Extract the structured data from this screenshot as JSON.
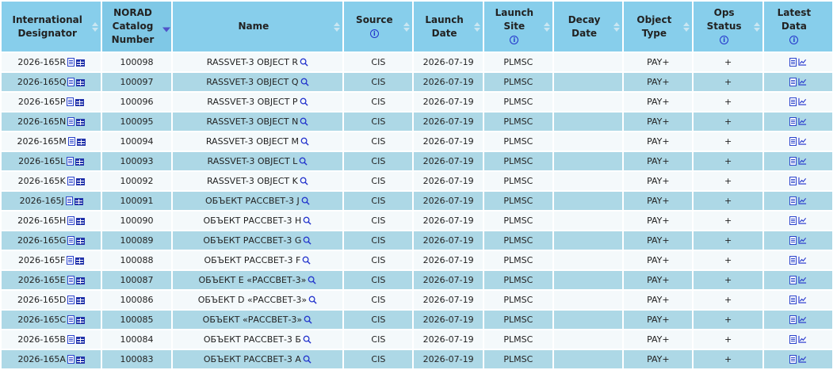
{
  "headers": {
    "intl": "International Designator",
    "norad": "NORAD Catalog Number",
    "name": "Name",
    "source": "Source",
    "launch_date": "Launch Date",
    "launch_site": "Launch Site",
    "decay": "Decay Date",
    "object_type": "Object Type",
    "ops_status": "Ops Status",
    "latest": "Latest Data",
    "info_glyph": "i"
  },
  "colors": {
    "header_bg": "#87ceeb",
    "row_light": "#f4f9fb",
    "row_dark": "#add8e6",
    "icon_blue": "#2233cc"
  },
  "icons": [
    "document-icon",
    "table-icon",
    "search-icon",
    "chart-icon",
    "info-icon",
    "sort-icon"
  ],
  "rows": [
    {
      "intl": "2026-165R",
      "norad": "100098",
      "name": "RASSVET-3 OBJECT R",
      "source": "CIS",
      "launch_date": "2026-07-19",
      "launch_site": "PLMSC",
      "decay": "",
      "type": "PAY+",
      "ops": "+"
    },
    {
      "intl": "2026-165Q",
      "norad": "100097",
      "name": "RASSVET-3 OBJECT Q",
      "source": "CIS",
      "launch_date": "2026-07-19",
      "launch_site": "PLMSC",
      "decay": "",
      "type": "PAY+",
      "ops": "+"
    },
    {
      "intl": "2026-165P",
      "norad": "100096",
      "name": "RASSVET-3 OBJECT P",
      "source": "CIS",
      "launch_date": "2026-07-19",
      "launch_site": "PLMSC",
      "decay": "",
      "type": "PAY+",
      "ops": "+"
    },
    {
      "intl": "2026-165N",
      "norad": "100095",
      "name": "RASSVET-3 OBJECT N",
      "source": "CIS",
      "launch_date": "2026-07-19",
      "launch_site": "PLMSC",
      "decay": "",
      "type": "PAY+",
      "ops": "+"
    },
    {
      "intl": "2026-165M",
      "norad": "100094",
      "name": "RASSVET-3 OBJECT M",
      "source": "CIS",
      "launch_date": "2026-07-19",
      "launch_site": "PLMSC",
      "decay": "",
      "type": "PAY+",
      "ops": "+"
    },
    {
      "intl": "2026-165L",
      "norad": "100093",
      "name": "RASSVET-3 OBJECT L",
      "source": "CIS",
      "launch_date": "2026-07-19",
      "launch_site": "PLMSC",
      "decay": "",
      "type": "PAY+",
      "ops": "+"
    },
    {
      "intl": "2026-165K",
      "norad": "100092",
      "name": "RASSVET-3 OBJECT K",
      "source": "CIS",
      "launch_date": "2026-07-19",
      "launch_site": "PLMSC",
      "decay": "",
      "type": "PAY+",
      "ops": "+"
    },
    {
      "intl": "2026-165J",
      "norad": "100091",
      "name": "ОБЪЕКТ РАССВЕТ-3 J",
      "source": "CIS",
      "launch_date": "2026-07-19",
      "launch_site": "PLMSC",
      "decay": "",
      "type": "PAY+",
      "ops": "+"
    },
    {
      "intl": "2026-165H",
      "norad": "100090",
      "name": "ОБЪЕКТ РАССВЕТ-3 H",
      "source": "CIS",
      "launch_date": "2026-07-19",
      "launch_site": "PLMSC",
      "decay": "",
      "type": "PAY+",
      "ops": "+"
    },
    {
      "intl": "2026-165G",
      "norad": "100089",
      "name": "ОБЪЕКТ РАССВЕТ-3 G",
      "source": "CIS",
      "launch_date": "2026-07-19",
      "launch_site": "PLMSC",
      "decay": "",
      "type": "PAY+",
      "ops": "+"
    },
    {
      "intl": "2026-165F",
      "norad": "100088",
      "name": "ОБЪЕКТ РАССВЕТ-3 F",
      "source": "CIS",
      "launch_date": "2026-07-19",
      "launch_site": "PLMSC",
      "decay": "",
      "type": "PAY+",
      "ops": "+"
    },
    {
      "intl": "2026-165E",
      "norad": "100087",
      "name": "ОБЪЕКТ Е «РАССВЕТ-3»",
      "source": "CIS",
      "launch_date": "2026-07-19",
      "launch_site": "PLMSC",
      "decay": "",
      "type": "PAY+",
      "ops": "+"
    },
    {
      "intl": "2026-165D",
      "norad": "100086",
      "name": "ОБЪЕКТ D «РАССВЕТ-3»",
      "source": "CIS",
      "launch_date": "2026-07-19",
      "launch_site": "PLMSC",
      "decay": "",
      "type": "PAY+",
      "ops": "+"
    },
    {
      "intl": "2026-165C",
      "norad": "100085",
      "name": "ОБЪЕКТ «РАССВЕТ-3»",
      "source": "CIS",
      "launch_date": "2026-07-19",
      "launch_site": "PLMSC",
      "decay": "",
      "type": "PAY+",
      "ops": "+"
    },
    {
      "intl": "2026-165B",
      "norad": "100084",
      "name": "ОБЪЕКТ РАССВЕТ-3 Б",
      "source": "CIS",
      "launch_date": "2026-07-19",
      "launch_site": "PLMSC",
      "decay": "",
      "type": "PAY+",
      "ops": "+"
    },
    {
      "intl": "2026-165A",
      "norad": "100083",
      "name": "ОБЪЕКТ РАССВЕТ-3 А",
      "source": "CIS",
      "launch_date": "2026-07-19",
      "launch_site": "PLMSC",
      "decay": "",
      "type": "PAY+",
      "ops": "+"
    }
  ]
}
